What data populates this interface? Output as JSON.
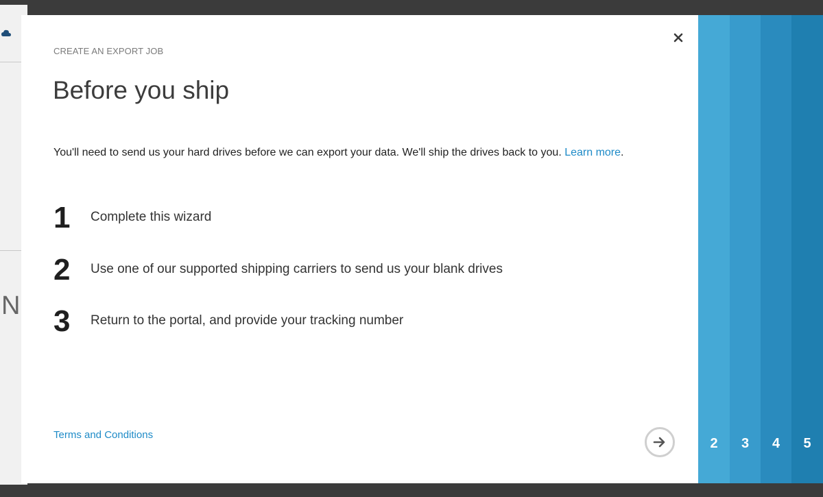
{
  "dialog": {
    "wizard_label": "CREATE AN EXPORT JOB",
    "title": "Before you ship",
    "intro_text": "You'll need to send us your hard drives before we can export your data. We'll ship the drives back to you. ",
    "learn_more_link": "Learn more",
    "intro_end": ".",
    "steps": [
      {
        "number": "1",
        "text": "Complete this wizard"
      },
      {
        "number": "2",
        "text": "Use one of our supported shipping carriers to send us your blank drives"
      },
      {
        "number": "3",
        "text": "Return to the portal, and provide your tracking number"
      }
    ],
    "terms_link": "Terms and Conditions",
    "close_icon": "close-icon",
    "next_icon": "arrow-right-icon"
  },
  "step_rail": {
    "items": [
      {
        "label": "2",
        "color": "#45a9d6"
      },
      {
        "label": "3",
        "color": "#389bcc"
      },
      {
        "label": "4",
        "color": "#2a8bbe"
      },
      {
        "label": "5",
        "color": "#1f7fb0"
      }
    ]
  },
  "background_page": {
    "partial_glyph": "N"
  }
}
